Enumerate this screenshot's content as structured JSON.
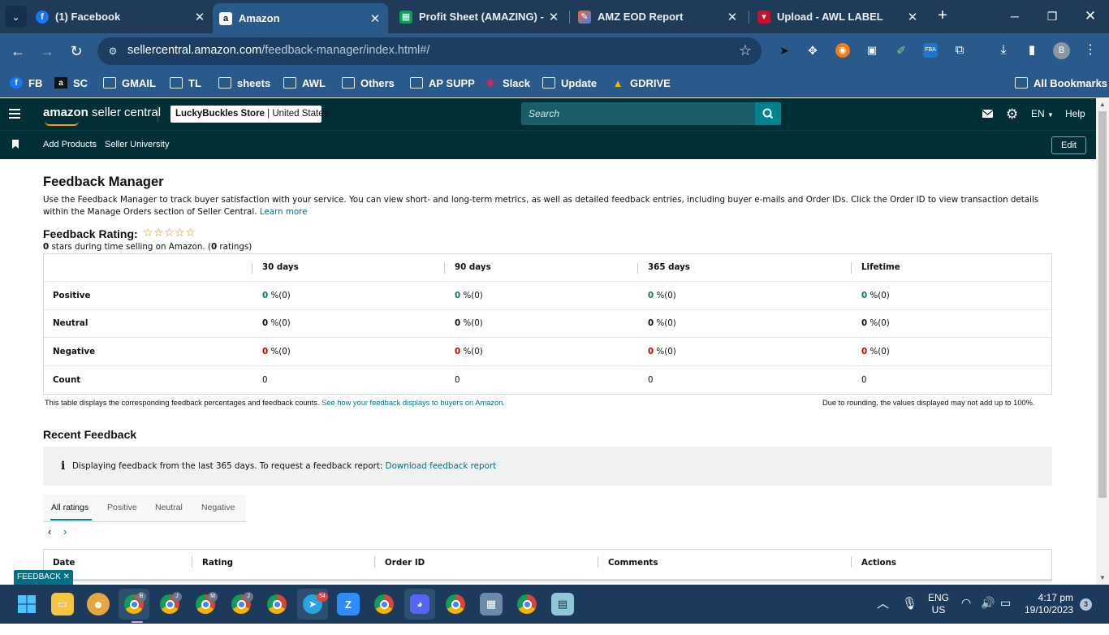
{
  "browser": {
    "tabs": [
      {
        "label": "(1) Facebook",
        "icon": "facebook-icon"
      },
      {
        "label": "Amazon",
        "icon": "amazon-icon"
      },
      {
        "label": "Profit Sheet (AMAZING) - G",
        "icon": "sheets-icon"
      },
      {
        "label": "AMZ EOD Report",
        "icon": "tasks-icon"
      },
      {
        "label": "Upload - AWL LABEL",
        "icon": "upload-icon"
      }
    ],
    "url_host": "sellercentral.amazon.com",
    "url_path": "/feedback-manager/index.html#/",
    "profile_initial": "B",
    "bookmarks": [
      "FB",
      "SC",
      "GMAIL",
      "TL",
      "sheets",
      "AWL",
      "Others",
      "AP SUPP",
      "Slack",
      "Update",
      "GDRIVE"
    ],
    "all_bookmarks": "All Bookmarks"
  },
  "header": {
    "logo_bold": "amazon",
    "logo_rest": " seller central",
    "store_name": "LuckyBuckles Store",
    "store_region": " | United States",
    "search_placeholder": "Search",
    "language": "EN",
    "help": "Help"
  },
  "subnav": {
    "links": [
      "Add Products",
      "Seller University"
    ],
    "edit": "Edit"
  },
  "page": {
    "title": "Feedback Manager",
    "description": "Use the Feedback Manager to track buyer satisfaction with your service. You can view short- and long-term metrics, as well as detailed feedback entries, including buyer e-mails and Order IDs. Click the Order ID to view transaction details within the Manage Orders section of Seller Central.",
    "learn_more": "Learn more",
    "rating_label": "Feedback Rating:",
    "stars": "☆☆☆☆☆",
    "rating_count_stars": "0",
    "rating_mid": " stars during time selling on Amazon. (",
    "rating_count": "0",
    "rating_end": " ratings)"
  },
  "feedback_table": {
    "columns": [
      "30 days",
      "90 days",
      "365 days",
      "Lifetime"
    ],
    "rows": [
      {
        "label": "Positive",
        "values": [
          "0",
          "0",
          "0",
          "0"
        ],
        "suffix": " %(0)"
      },
      {
        "label": "Neutral",
        "values": [
          "0",
          "0",
          "0",
          "0"
        ],
        "suffix": " %(0)"
      },
      {
        "label": "Negative",
        "values": [
          "0",
          "0",
          "0",
          "0"
        ],
        "suffix": " %(0)"
      },
      {
        "label": "Count",
        "values": [
          "0",
          "0",
          "0",
          "0"
        ],
        "suffix": ""
      }
    ],
    "note_left": "This table displays the corresponding feedback percentages and feedback counts.",
    "note_link": "See how your feedback displays to buyers on Amazon.",
    "note_right": "Due to rounding, the values displayed may not add up to 100%."
  },
  "recent": {
    "title": "Recent Feedback",
    "info_text": "Displaying feedback from the last 365 days. To request a feedback report:",
    "info_link": "Download feedback report",
    "tabs": [
      "All ratings",
      "Positive",
      "Neutral",
      "Negative"
    ],
    "columns": [
      "Date",
      "Rating",
      "Order ID",
      "Comments",
      "Actions"
    ]
  },
  "feedback_button": "FEEDBACK ✕",
  "taskbar": {
    "badges": [
      "B",
      "J",
      "M",
      "J",
      "54",
      "3"
    ],
    "lang_top": "ENG",
    "lang_bottom": "US",
    "time": "4:17 pm",
    "date": "19/10/2023",
    "notifications": "3"
  }
}
